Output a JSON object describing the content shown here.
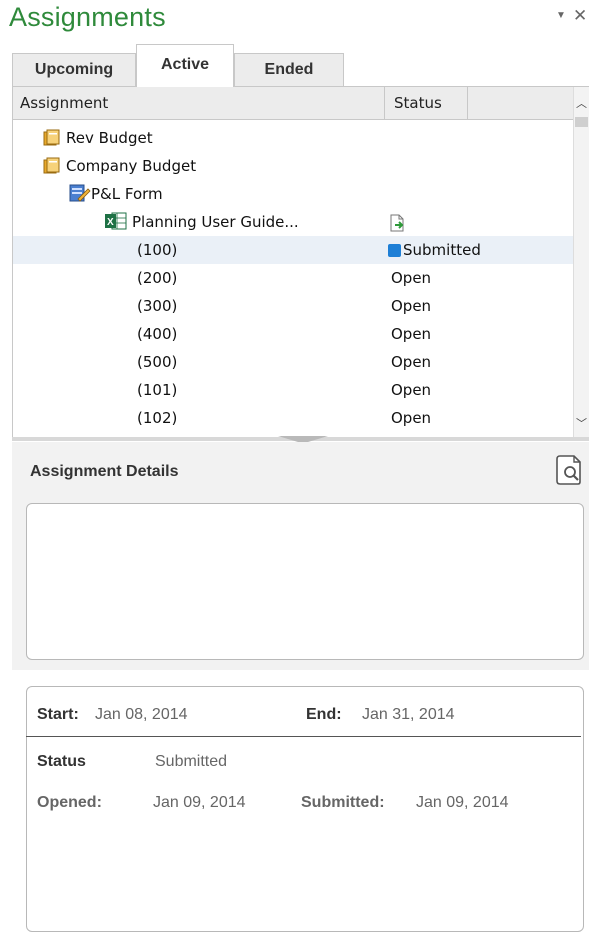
{
  "pane": {
    "title": "Assignments",
    "menu_glyph": "▼",
    "close_glyph": "✕"
  },
  "tabs": [
    {
      "label": "Upcoming",
      "active": false
    },
    {
      "label": "Active",
      "active": true
    },
    {
      "label": "Ended",
      "active": false
    }
  ],
  "grid": {
    "columns": [
      "Assignment",
      "Status"
    ],
    "rows": [
      {
        "label": "Rev Budget",
        "icon": "folder-icon",
        "status": ""
      },
      {
        "label": "Company Budget",
        "icon": "folder-icon",
        "status": ""
      },
      {
        "label": "P&L Form",
        "icon": "form-icon",
        "status": ""
      },
      {
        "label": "Planning User Guide...",
        "icon": "excel-icon",
        "status": "",
        "status_icon": "open-document-icon"
      },
      {
        "label": "(100)",
        "status": "Submitted",
        "status_icon": "submitted-square-icon",
        "selected": true
      },
      {
        "label": "(200)",
        "status": "Open"
      },
      {
        "label": "(300)",
        "status": "Open"
      },
      {
        "label": "(400)",
        "status": "Open"
      },
      {
        "label": "(500)",
        "status": "Open"
      },
      {
        "label": "(101)",
        "status": "Open"
      },
      {
        "label": "(102)",
        "status": "Open"
      }
    ]
  },
  "details": {
    "title": "Assignment Details",
    "icon": "document-search-icon",
    "start_label": "Start:",
    "start_value": "Jan 08, 2014",
    "end_label": "End:",
    "end_value": "Jan 31, 2014",
    "status_label": "Status",
    "status_value": "Submitted",
    "opened_label": "Opened:",
    "opened_value": "Jan 09, 2014",
    "submitted_label": "Submitted:",
    "submitted_value": "Jan 09, 2014"
  },
  "colors": {
    "title_green": "#2f8a3b",
    "submitted_blue": "#1e7fd6",
    "selected_row": "#eaf0f7"
  }
}
